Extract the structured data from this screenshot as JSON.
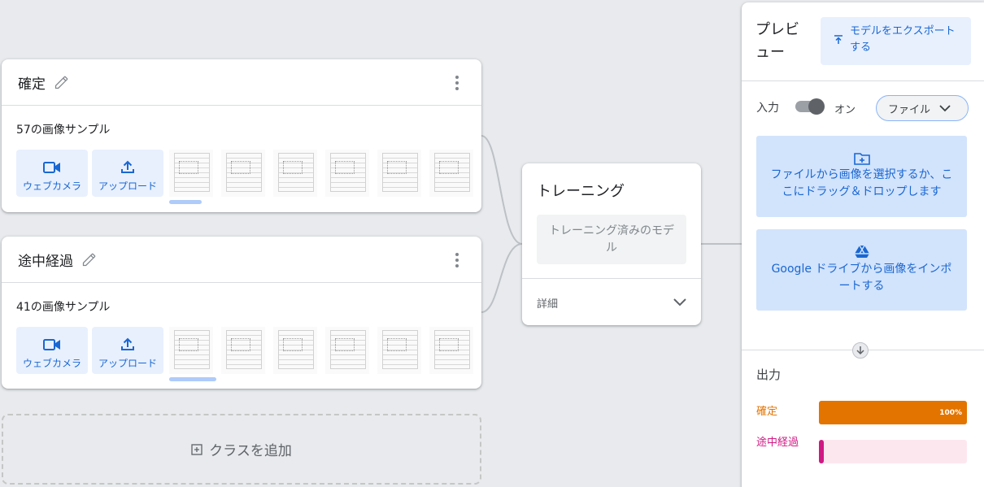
{
  "classes": [
    {
      "name": "確定",
      "samples": "57の画像サンプル",
      "webcam": "ウェブカメラ",
      "upload": "アップロード",
      "thumb_count": 6
    },
    {
      "name": "途中経過",
      "samples": "41の画像サンプル",
      "webcam": "ウェブカメラ",
      "upload": "アップロード",
      "thumb_count": 6
    }
  ],
  "add_class": "クラスを追加",
  "training": {
    "title": "トレーニング",
    "trained_button": "トレーニング済みのモデル",
    "details": "詳細"
  },
  "preview": {
    "title": "プレビュー",
    "export_button": "モデルをエクスポートする",
    "input_label": "入力",
    "toggle_label": "オン",
    "toggle_on": true,
    "source_select": "ファイル",
    "file_drop": "ファイルから画像を選択するか、ここにドラッグ＆ドロップします",
    "drive_import": "Google ドライブから画像をインポートする",
    "output_label": "出力",
    "results": [
      {
        "label": "確定",
        "percent": 100,
        "percent_text": "100%",
        "color": "#e37400",
        "track": "#fce8e6"
      },
      {
        "label": "途中経過",
        "percent": 0,
        "percent_text": "",
        "color": "#d01884",
        "track": "#fde7ee"
      }
    ]
  },
  "colors": {
    "accent": "#1967d2",
    "accent_bg": "#e8f0fe",
    "drop_bg": "#d2e3fc"
  }
}
